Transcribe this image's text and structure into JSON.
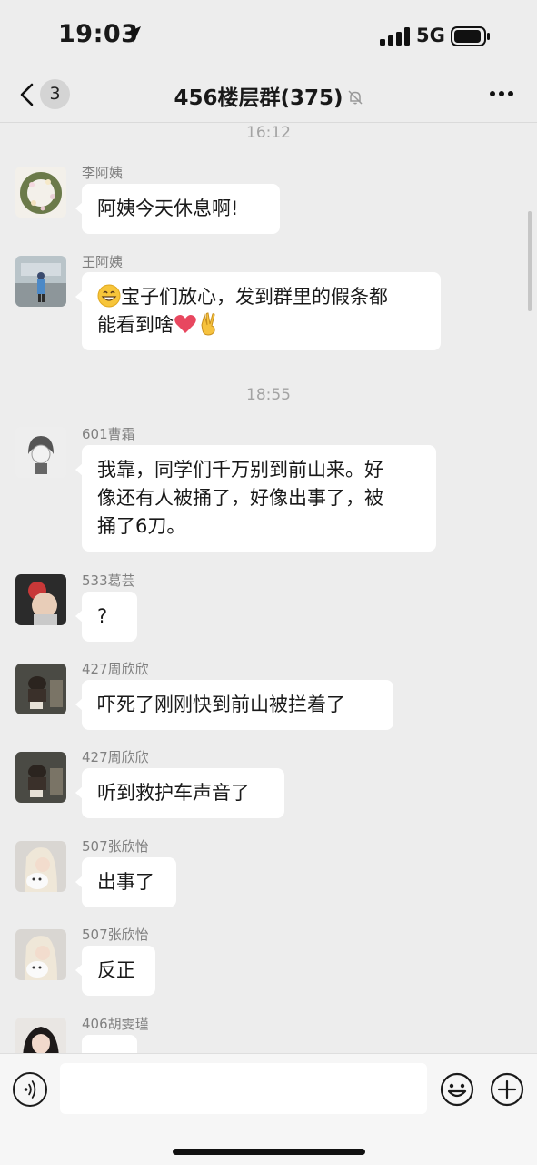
{
  "status_bar": {
    "time": "19:03",
    "network": "5G"
  },
  "nav": {
    "unread_count": "3",
    "title": "456楼层群(375)"
  },
  "messages": [
    {
      "type": "time",
      "text": "16:12"
    },
    {
      "type": "msg",
      "sender": "李阿姨",
      "text": "阿姨今天休息啊!"
    },
    {
      "type": "msg",
      "sender": "王阿姨",
      "line1": "宝子们放心，发到群里的假条都",
      "line2": "能看到啥"
    },
    {
      "type": "time",
      "text": "18:55"
    },
    {
      "type": "msg",
      "sender": "601曹霜",
      "line1": "我靠，同学们千万别到前山来。好",
      "line2": "像还有人被捅了，好像出事了，被",
      "line3": "捅了6刀。"
    },
    {
      "type": "msg",
      "sender": "533葛芸",
      "text": "?"
    },
    {
      "type": "msg",
      "sender": "427周欣欣",
      "text": "吓死了刚刚快到前山被拦着了"
    },
    {
      "type": "msg",
      "sender": "427周欣欣",
      "text": "听到救护车声音了"
    },
    {
      "type": "msg",
      "sender": "507张欣怡",
      "text": "出事了"
    },
    {
      "type": "msg",
      "sender": "507张欣怡",
      "text": "反正"
    },
    {
      "type": "msg",
      "sender": "406胡雯瑾",
      "text": ""
    }
  ],
  "icons": {
    "location": "location-arrow-icon",
    "signal": "cellular-signal-icon",
    "battery": "battery-icon",
    "back": "chevron-left-icon",
    "mute": "bell-slash-icon",
    "more": "more-dots-icon",
    "grin": "grinning-face-emoji",
    "heart": "red-heart-emoji",
    "victory": "victory-hand-emoji",
    "voice": "voice-input-icon",
    "emoji": "smiley-face-icon",
    "plus": "plus-circle-icon"
  },
  "colors": {
    "background": "#ededed",
    "bubble": "#ffffff",
    "timestamp": "#a3a3a3",
    "sender": "#808080",
    "heart": "#e8475f",
    "victory": "#f6c23e"
  }
}
